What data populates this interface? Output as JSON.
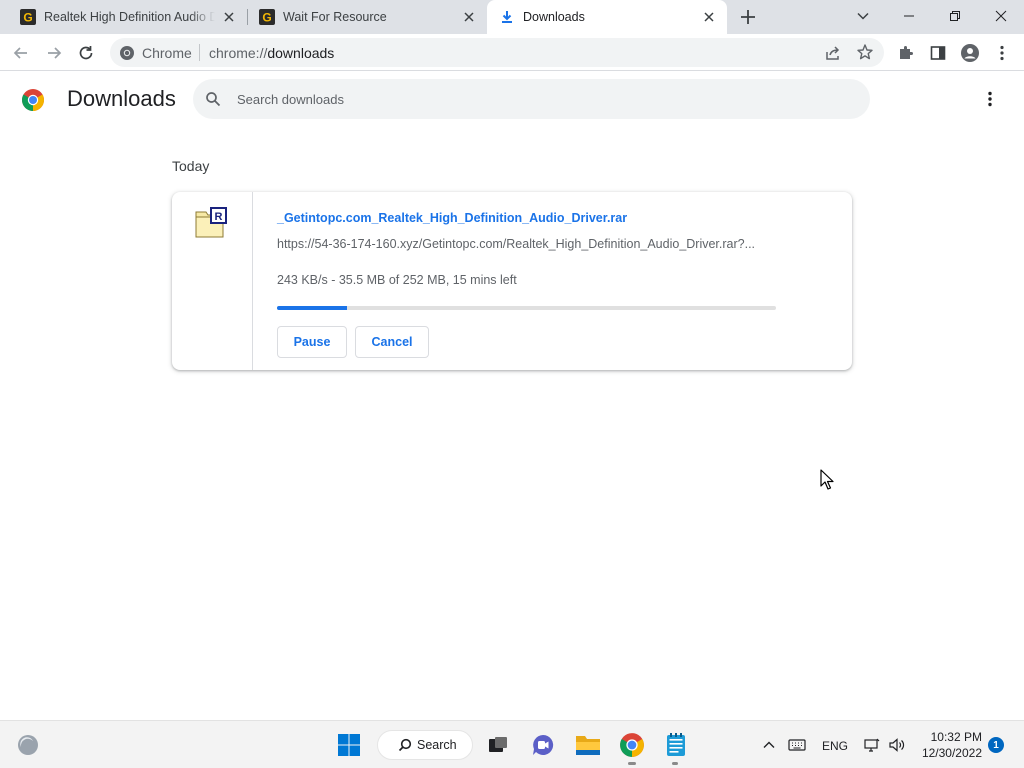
{
  "tabs": [
    {
      "title": "Realtek High Definition Audio Driver",
      "favicon": "getintopc-g-icon",
      "active": false
    },
    {
      "title": "Wait For Resource",
      "favicon": "getintopc-g-icon",
      "active": false
    },
    {
      "title": "Downloads",
      "favicon": "download-arrow-icon",
      "active": true
    }
  ],
  "toolbar": {
    "chip_label": "Chrome",
    "url_scheme": "chrome://",
    "url_host": "downloads"
  },
  "downloads_page": {
    "heading": "Downloads",
    "search_placeholder": "Search downloads",
    "date_group": "Today",
    "item": {
      "file_name": "_Getintopc.com_Realtek_High_Definition_Audio_Driver.rar",
      "url": "https://54-36-174-160.xyz/Getintopc.com/Realtek_High_Definition_Audio_Driver.rar?...",
      "status": "243 KB/s - 35.5 MB of 252 MB, 15 mins left",
      "progress_fraction": 0.141,
      "pause_label": "Pause",
      "cancel_label": "Cancel"
    }
  },
  "taskbar": {
    "search_label": "Search",
    "language": "ENG",
    "time": "10:32 PM",
    "date": "12/30/2022",
    "notification_count": "1"
  },
  "colors": {
    "accent": "#1a73e8",
    "tabstrip": "#dee1e6",
    "omnibox": "#f1f3f4"
  }
}
